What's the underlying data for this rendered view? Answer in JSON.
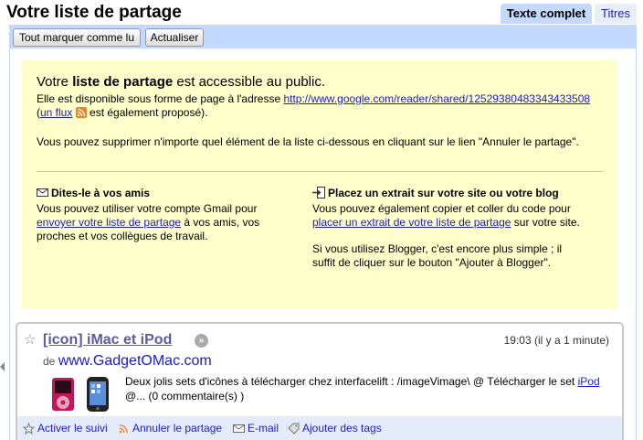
{
  "header": {
    "title": "Votre liste de partage",
    "tabs": {
      "full": "Texte complet",
      "titles": "Titres"
    }
  },
  "toolbar": {
    "mark_all": "Tout marquer comme lu",
    "refresh": "Actualiser"
  },
  "notice": {
    "title_pre": "Votre ",
    "title_bold": "liste de partage",
    "title_post": " est accessible au public.",
    "line1_pre": "Elle est disponible sous forme de page à l'adresse ",
    "url": "http://www.google.com/reader/shared/12529380483343433508",
    "line1_mid": " (",
    "feed_link": "un flux",
    "line1_post": " est également proposé).",
    "remove_text": "Vous pouvez supprimer n'importe quel élément de la liste ci-dessous en cliquant sur le lien \"Annuler le partage\".",
    "share": {
      "heading": "Dites-le à vos amis",
      "pre": "Vous pouvez utiliser votre compte Gmail pour ",
      "link": "envoyer votre liste de partage",
      "post": " à vos amis, vos proches et vos collègues de travail."
    },
    "embed": {
      "heading": "Placez un extrait sur votre site ou votre blog",
      "pre": "Vous pouvez également copier et coller du code pour ",
      "link": "placer un extrait de votre liste de partage",
      "post": " sur votre site.",
      "blogger": "Si vous utilisez Blogger, c'est encore plus simple ; il suffit de cliquer sur le bouton \"Ajouter à Blogger\"."
    }
  },
  "entry": {
    "title": "[icon] iMac et iPod",
    "time": "19:03 (il y a 1 minute)",
    "source_prefix": "de ",
    "source": "www.GadgetOMac.com",
    "body_pre": "Deux jolis sets d'icônes à télécharger chez interfacelift : /imageVimage\\ @ Télécharger le set ",
    "body_link": "iPod",
    "body_post": " @... (0 commentaire(s) )"
  },
  "actions": {
    "follow": "Activer le suivi",
    "unshare": "Annuler le partage",
    "email": "E-mail",
    "tags": "Ajouter des tags"
  },
  "colors": {
    "accent": "#c3d9ff",
    "notice_bg": "#ffffcc",
    "link": "#1a1ad8"
  }
}
